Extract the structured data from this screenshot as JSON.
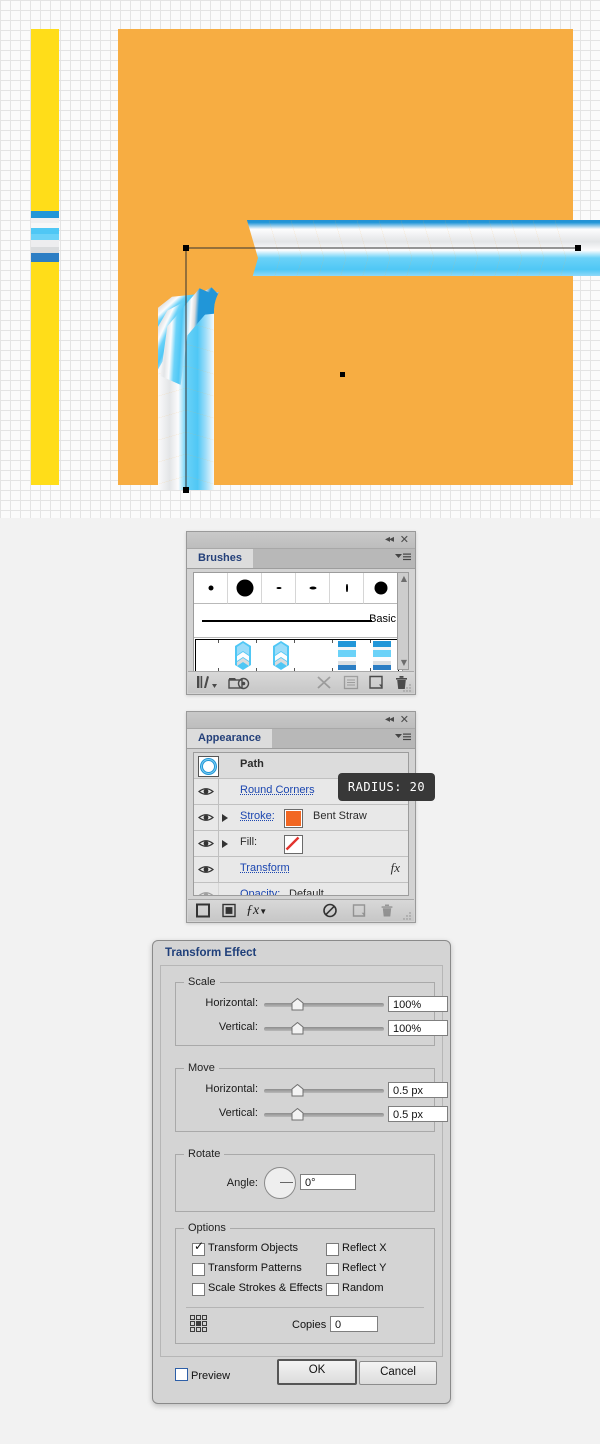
{
  "artboard": {
    "name": "illustrator-artboard",
    "background_color": "#F7AD42",
    "grid_color": "#e4e4e4",
    "left_strip_color": "#FFDD19",
    "strip_bands": [
      {
        "color": "#2196D8",
        "height": 7
      },
      {
        "color": "#EFEFF1",
        "height": 5
      },
      {
        "color": "#F7F7F8",
        "height": 5
      },
      {
        "color": "#4FC7F5",
        "height": 6
      },
      {
        "color": "#6BD2F8",
        "height": 6
      },
      {
        "color": "#EDEDEF",
        "height": 6
      },
      {
        "color": "#D9DBDD",
        "height": 5
      },
      {
        "color": "#2C7EC4",
        "height": 8
      },
      {
        "color": "#2D7FC6",
        "height": 5
      }
    ],
    "straw": {
      "label": "bent-straw-artwork",
      "colors": {
        "dark_blue": "#2C7EC4",
        "mid_blue": "#2196D8",
        "light_blue": "#4FC7F5",
        "pale_blue": "#9ADCF9",
        "white": "#FCFCFD",
        "light_gray": "#E3E5E7",
        "mid_gray": "#B9BDC1",
        "shadow_gray": "#9AA0A6"
      },
      "segments": 14
    },
    "selection": {
      "anchor_color": "#000000",
      "path_color": "#333333"
    }
  },
  "brushes_panel": {
    "title": "Brushes",
    "tab_label": "Brushes",
    "collapse_icon": "collapse-icon",
    "close_icon": "close-icon",
    "menu_icon": "panel-menu-icon",
    "basic_label": "Basic",
    "calligraphic_brushes": [
      {
        "name": "brush-1",
        "size": 5
      },
      {
        "name": "brush-2",
        "size": 16
      },
      {
        "name": "brush-3",
        "size": 4
      },
      {
        "name": "brush-4",
        "size": 6
      },
      {
        "name": "brush-5",
        "size": 3
      },
      {
        "name": "brush-6",
        "size": 12
      }
    ],
    "art_brushes": [
      {
        "name": "art-brush-straw-1"
      },
      {
        "name": "art-brush-straw-2"
      },
      {
        "name": "art-brush-stripe-1"
      },
      {
        "name": "art-brush-stripe-2"
      }
    ],
    "footer_icons": [
      {
        "name": "brush-libraries-icon",
        "enabled": true
      },
      {
        "name": "libraries-panel-icon",
        "enabled": true
      },
      {
        "name": "remove-brush-stroke-icon",
        "enabled": false
      },
      {
        "name": "brush-options-icon",
        "enabled": false
      },
      {
        "name": "new-brush-icon",
        "enabled": true
      },
      {
        "name": "delete-brush-icon",
        "enabled": true
      }
    ]
  },
  "appearance_panel": {
    "title": "Appearance",
    "tab_label": "Appearance",
    "collapse_icon": "collapse-icon",
    "close_icon": "close-icon",
    "menu_icon": "panel-menu-icon",
    "target_label": "Path",
    "rows": [
      {
        "name": "round-corners-row",
        "label": "Round Corners",
        "value": "",
        "link": true,
        "eye": true,
        "disclosure": false
      },
      {
        "name": "stroke-row",
        "label": "Stroke:",
        "value": "Bent Straw",
        "link": true,
        "eye": true,
        "disclosure": true,
        "swatch": "#F26722"
      },
      {
        "name": "fill-row",
        "label": "Fill:",
        "value": "",
        "link": false,
        "eye": true,
        "disclosure": true,
        "swatch": "none"
      },
      {
        "name": "transform-row",
        "label": "Transform",
        "value": "",
        "link": true,
        "eye": true,
        "disclosure": false,
        "fx": "fx"
      },
      {
        "name": "opacity-row",
        "label": "Opacity:",
        "value": "Default",
        "link": true,
        "eye": false,
        "disclosure": false
      }
    ],
    "footer_icons": [
      {
        "name": "add-new-stroke-icon",
        "enabled": true
      },
      {
        "name": "add-new-fill-icon",
        "enabled": true
      },
      {
        "name": "add-new-effect-icon",
        "enabled": true,
        "glyph": "fx"
      },
      {
        "name": "clear-appearance-icon",
        "enabled": true
      },
      {
        "name": "duplicate-item-icon",
        "enabled": false
      },
      {
        "name": "delete-item-icon",
        "enabled": false
      }
    ]
  },
  "tooltip": {
    "name": "radius-tooltip",
    "text": "RADIUS: 20",
    "background": "#383838",
    "color": "#ffffff"
  },
  "transform_dialog": {
    "title": "Transform Effect",
    "scale": {
      "legend": "Scale",
      "horizontal_label": "Horizontal:",
      "horizontal_value": "100%",
      "vertical_label": "Vertical:",
      "vertical_value": "100%"
    },
    "move": {
      "legend": "Move",
      "horizontal_label": "Horizontal:",
      "horizontal_value": "0.5 px",
      "vertical_label": "Vertical:",
      "vertical_value": "0.5 px"
    },
    "rotate": {
      "legend": "Rotate",
      "angle_label": "Angle:",
      "angle_value": "0°",
      "dial_name": "angle-dial"
    },
    "options": {
      "legend": "Options",
      "checkboxes": [
        {
          "name": "transform-objects-checkbox",
          "label": "Transform Objects",
          "checked": true
        },
        {
          "name": "transform-patterns-checkbox",
          "label": "Transform Patterns",
          "checked": false
        },
        {
          "name": "scale-strokes-effects-checkbox",
          "label": "Scale Strokes & Effects",
          "checked": false
        },
        {
          "name": "reflect-x-checkbox",
          "label": "Reflect X",
          "checked": false
        },
        {
          "name": "reflect-y-checkbox",
          "label": "Reflect Y",
          "checked": false
        },
        {
          "name": "random-checkbox",
          "label": "Random",
          "checked": false
        }
      ],
      "copies_label": "Copies",
      "copies_value": "0",
      "reference_point_name": "reference-point-selector"
    },
    "preview_label": "Preview",
    "preview_checked": false,
    "ok_label": "OK",
    "cancel_label": "Cancel"
  }
}
